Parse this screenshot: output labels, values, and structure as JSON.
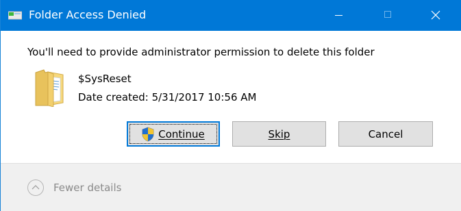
{
  "window": {
    "title": "Folder Access Denied",
    "icons": {
      "app": "folder-drive-icon",
      "minimize": "minimize-icon",
      "maximize": "maximize-icon",
      "close": "close-icon"
    }
  },
  "dialog": {
    "message": "You'll need to provide administrator permission to delete this folder",
    "item": {
      "icon": "folder-icon",
      "name": "$SysReset",
      "date_created": "Date created: 5/31/2017 10:56 AM"
    },
    "buttons": {
      "continue": {
        "label": "Continue",
        "access_key": "C",
        "icon": "uac-shield-icon"
      },
      "skip": {
        "label": "Skip",
        "access_key": "S"
      },
      "cancel": {
        "label": "Cancel"
      }
    }
  },
  "footer": {
    "toggle_label": "Fewer details",
    "toggle_icon": "chevron-up-icon"
  },
  "colors": {
    "titlebar": "#0078d7",
    "button_face": "#e1e1e1",
    "button_focus_border": "#0078d7",
    "footer_bg": "#f0f0f0",
    "footer_text": "#8a8a8a"
  }
}
